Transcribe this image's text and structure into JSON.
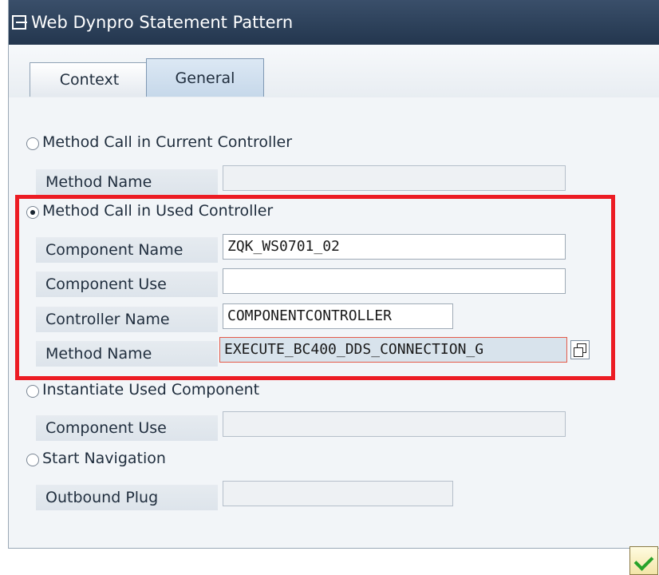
{
  "window": {
    "title": "Web Dynpro Statement Pattern"
  },
  "tabs": [
    {
      "label": "Context",
      "active": false
    },
    {
      "label": "General",
      "active": true
    }
  ],
  "options": {
    "current_controller": {
      "radio_label": "Method Call in Current Controller",
      "selected": false,
      "fields": {
        "method_name": {
          "label": "Method Name",
          "value": ""
        }
      }
    },
    "used_controller": {
      "radio_label": "Method Call in Used Controller",
      "selected": true,
      "fields": {
        "component_name": {
          "label": "Component Name",
          "value": "ZQK_WS0701_02"
        },
        "component_use": {
          "label": "Component Use",
          "value": ""
        },
        "controller_name": {
          "label": "Controller Name",
          "value": "COMPONENTCONTROLLER"
        },
        "method_name": {
          "label": "Method Name",
          "value": "EXECUTE_BC400_DDS_CONNECTION_G"
        }
      }
    },
    "instantiate": {
      "radio_label": "Instantiate Used Component",
      "selected": false,
      "fields": {
        "component_use": {
          "label": "Component Use",
          "value": ""
        }
      }
    },
    "navigation": {
      "radio_label": "Start Navigation",
      "selected": false,
      "fields": {
        "outbound_plug": {
          "label": "Outbound Plug",
          "value": ""
        }
      }
    }
  },
  "colors": {
    "highlight": "#ec1c24",
    "title_bar": "#2b3f58",
    "ok_check": "#27a22a"
  },
  "icons": [
    "window-icon",
    "value-help-icon",
    "confirm-check-icon"
  ]
}
